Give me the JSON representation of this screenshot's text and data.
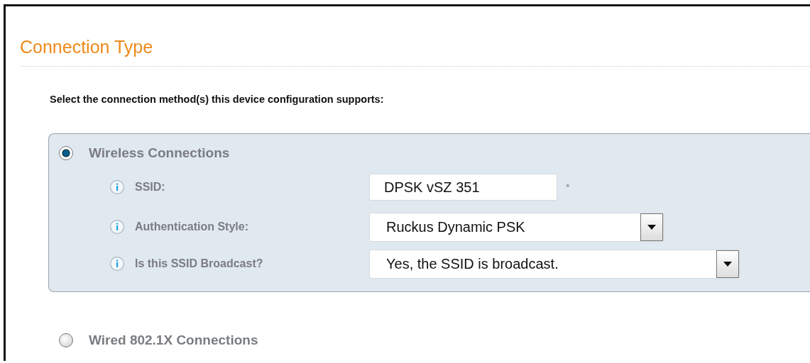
{
  "title": "Connection Type",
  "instruction": "Select the connection method(s) this device configuration supports:",
  "options": [
    {
      "label": "Wireless Connections",
      "selected": true,
      "fields": [
        {
          "kind": "text",
          "label": "SSID:",
          "value": "DPSK vSZ 351",
          "required_mark": "*"
        },
        {
          "kind": "select",
          "label": "Authentication Style:",
          "value": "Ruckus Dynamic PSK"
        },
        {
          "kind": "select",
          "label": "Is this SSID Broadcast?",
          "value": "Yes, the SSID is broadcast."
        }
      ]
    },
    {
      "label": "Wired 802.1X Connections",
      "selected": false
    }
  ]
}
